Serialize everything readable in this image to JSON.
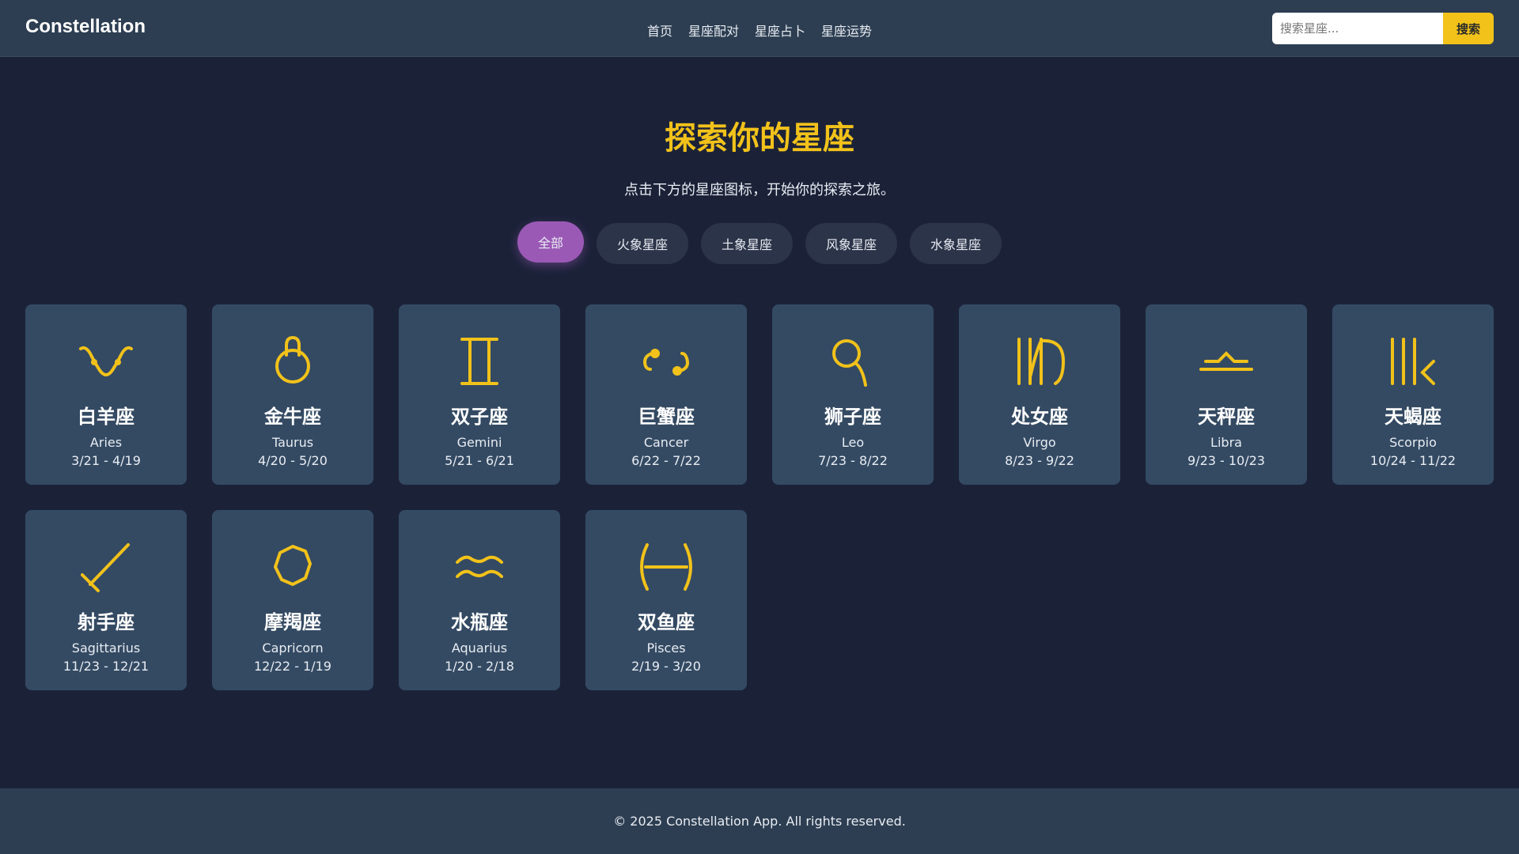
{
  "header": {
    "brand": "Constellation",
    "nav": [
      "首页",
      "星座配对",
      "星座占卜",
      "星座运势"
    ],
    "search_placeholder": "搜索星座...",
    "search_button": "搜索"
  },
  "hero": {
    "title": "探索你的星座",
    "subtitle": "点击下方的星座图标，开始你的探索之旅。"
  },
  "filters": [
    "全部",
    "火象星座",
    "土象星座",
    "风象星座",
    "水象星座"
  ],
  "signs": [
    {
      "cn": "白羊座",
      "en": "Aries",
      "dates": "3/21 - 4/19",
      "icon": "aries-icon"
    },
    {
      "cn": "金牛座",
      "en": "Taurus",
      "dates": "4/20 - 5/20",
      "icon": "taurus-icon"
    },
    {
      "cn": "双子座",
      "en": "Gemini",
      "dates": "5/21 - 6/21",
      "icon": "gemini-icon"
    },
    {
      "cn": "巨蟹座",
      "en": "Cancer",
      "dates": "6/22 - 7/22",
      "icon": "cancer-icon"
    },
    {
      "cn": "狮子座",
      "en": "Leo",
      "dates": "7/23 - 8/22",
      "icon": "leo-icon"
    },
    {
      "cn": "处女座",
      "en": "Virgo",
      "dates": "8/23 - 9/22",
      "icon": "virgo-icon"
    },
    {
      "cn": "天秤座",
      "en": "Libra",
      "dates": "9/23 - 10/23",
      "icon": "libra-icon"
    },
    {
      "cn": "天蝎座",
      "en": "Scorpio",
      "dates": "10/24 - 11/22",
      "icon": "scorpio-icon"
    },
    {
      "cn": "射手座",
      "en": "Sagittarius",
      "dates": "11/23 - 12/21",
      "icon": "sagittarius-icon"
    },
    {
      "cn": "摩羯座",
      "en": "Capricorn",
      "dates": "12/22 - 1/19",
      "icon": "capricorn-icon"
    },
    {
      "cn": "水瓶座",
      "en": "Aquarius",
      "dates": "1/20 - 2/18",
      "icon": "aquarius-icon"
    },
    {
      "cn": "双鱼座",
      "en": "Pisces",
      "dates": "2/19 - 3/20",
      "icon": "pisces-icon"
    }
  ],
  "footer": "© 2025 Constellation App. All rights reserved.",
  "colors": {
    "accent": "#f2c21a",
    "active_filter": "#9b59b6",
    "card": "#344a63",
    "background": "#1b2238",
    "header": "#2d3e52"
  }
}
